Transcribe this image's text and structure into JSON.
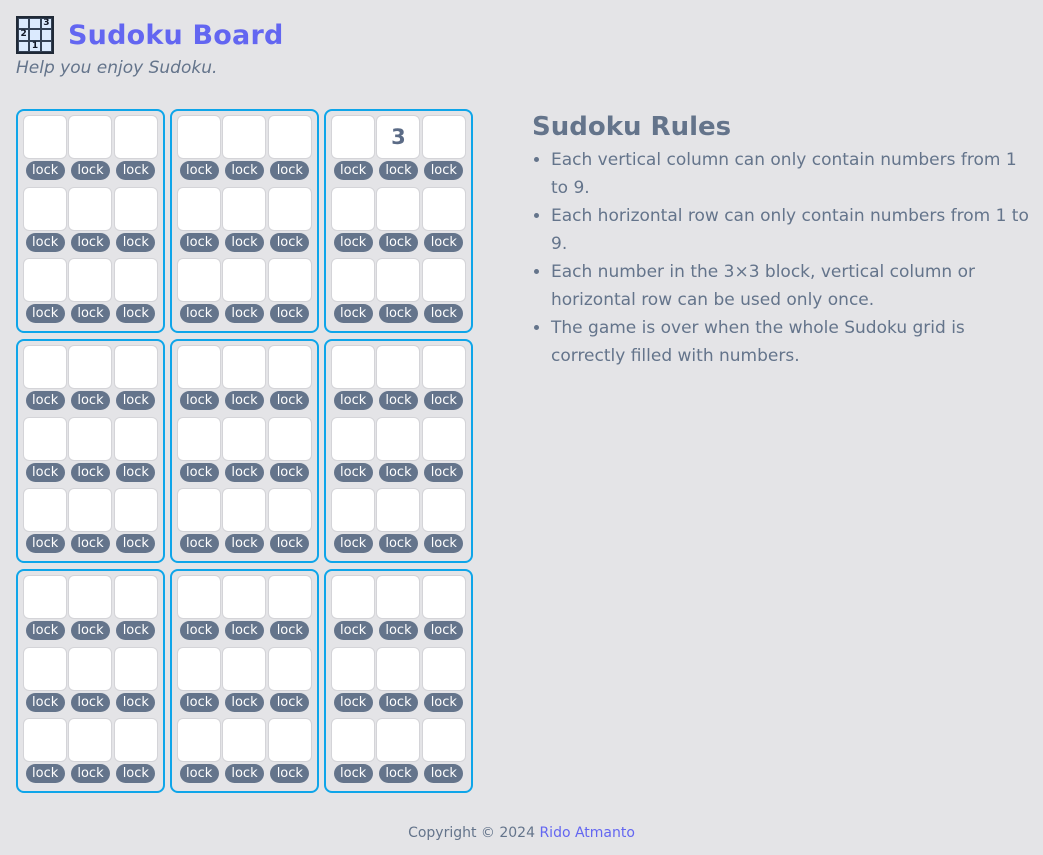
{
  "header": {
    "title": "Sudoku Board",
    "subtitle": "Help you enjoy Sudoku.",
    "logo_icon": "sudoku-grid-icon",
    "logo_digits": [
      "",
      "",
      "3",
      "2",
      "",
      "",
      "",
      "1",
      ""
    ]
  },
  "board": {
    "lock_label": "lock",
    "cells": [
      [
        "",
        "",
        "",
        "",
        "",
        "",
        "",
        "",
        ""
      ],
      [
        "",
        "",
        "",
        "",
        "",
        "",
        "",
        "",
        ""
      ],
      [
        "",
        "3",
        "",
        "",
        "",
        "",
        "",
        "",
        ""
      ],
      [
        "",
        "",
        "",
        "",
        "",
        "",
        "",
        "",
        ""
      ],
      [
        "",
        "",
        "",
        "",
        "",
        "",
        "",
        "",
        ""
      ],
      [
        "",
        "",
        "",
        "",
        "",
        "",
        "",
        "",
        ""
      ],
      [
        "",
        "",
        "",
        "",
        "",
        "",
        "",
        "",
        ""
      ],
      [
        "",
        "",
        "",
        "",
        "",
        "",
        "",
        "",
        ""
      ],
      [
        "",
        "",
        "",
        "",
        "",
        "",
        "",
        "",
        ""
      ]
    ]
  },
  "rules": {
    "title": "Sudoku Rules",
    "items": [
      "Each vertical column can only contain numbers from 1 to 9.",
      "Each horizontal row can only contain numbers from 1 to 9.",
      "Each number in the 3×3 block, vertical column or horizontal row can be used only once.",
      "The game is over when the whole Sudoku grid is correctly filled with numbers."
    ]
  },
  "footer": {
    "copyright": "Copyright © 2024 ",
    "author": "Rido Atmanto"
  },
  "colors": {
    "accent": "#6366f1",
    "block_border": "#0ea5e9",
    "lock_bg": "#64748b",
    "background": "#e4e4e7"
  }
}
